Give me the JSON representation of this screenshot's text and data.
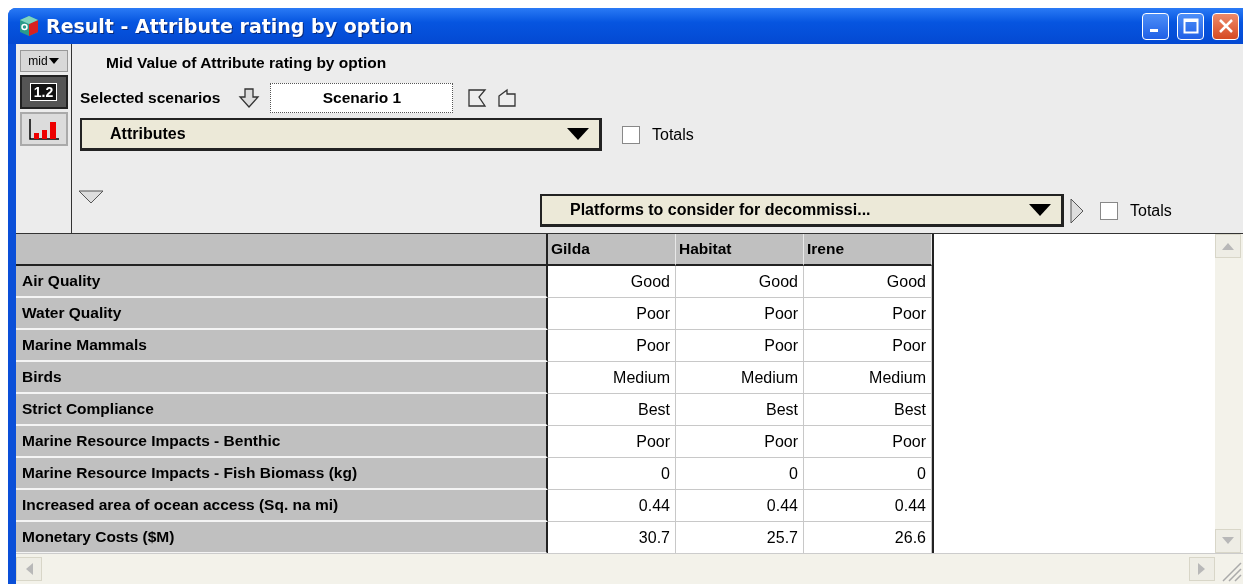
{
  "window": {
    "title": "Result - Attribute rating by option"
  },
  "tool_strip": {
    "mode_label": "mid",
    "table_view": {
      "label": "1.2",
      "selected": true
    },
    "chart_view": {
      "selected": false
    }
  },
  "heading": "Mid Value of Attribute rating by option",
  "scenario": {
    "label": "Selected scenarios",
    "value": "Scenario 1"
  },
  "row_index": {
    "value": "Attributes",
    "totals": {
      "label": "Totals",
      "checked": false
    }
  },
  "column_index": {
    "value": "Platforms to consider for decommissi...",
    "totals": {
      "label": "Totals",
      "checked": false
    }
  },
  "table": {
    "columns": [
      "Gilda",
      "Habitat",
      "Irene"
    ],
    "rows": [
      {
        "label": "Air Quality",
        "values": [
          "Good",
          "Good",
          "Good"
        ]
      },
      {
        "label": "Water Quality",
        "values": [
          "Poor",
          "Poor",
          "Poor"
        ]
      },
      {
        "label": "Marine Mammals",
        "values": [
          "Poor",
          "Poor",
          "Poor"
        ]
      },
      {
        "label": "Birds",
        "values": [
          "Medium",
          "Medium",
          "Medium"
        ]
      },
      {
        "label": "Strict Compliance",
        "values": [
          "Best",
          "Best",
          "Best"
        ]
      },
      {
        "label": "Marine Resource Impacts - Benthic",
        "values": [
          "Poor",
          "Poor",
          "Poor"
        ]
      },
      {
        "label": "Marine Resource Impacts - Fish Biomass (kg)",
        "values": [
          "0",
          "0",
          "0"
        ]
      },
      {
        "label": "Increased area of ocean access (Sq. na mi)",
        "values": [
          "0.44",
          "0.44",
          "0.44"
        ]
      },
      {
        "label": "Monetary Costs ($M)",
        "values": [
          "30.7",
          "25.7",
          "26.6"
        ]
      }
    ]
  }
}
